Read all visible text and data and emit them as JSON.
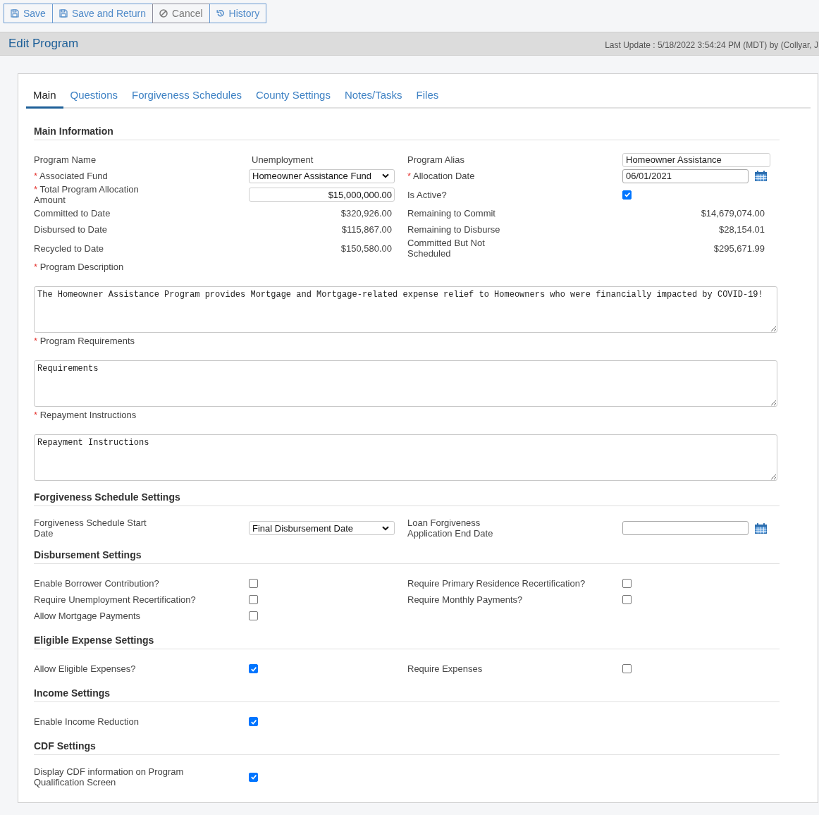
{
  "toolbar": [
    {
      "kind": "save",
      "label": "Save"
    },
    {
      "kind": "save_return",
      "label": "Save and Return"
    },
    {
      "kind": "cancel",
      "label": "Cancel"
    },
    {
      "kind": "history",
      "label": "History"
    }
  ],
  "header": {
    "title": "Edit Program",
    "last_update": "Last Update : 5/18/2022 3:54:24 PM (MDT) by (Collyar, J"
  },
  "tabs": [
    {
      "label": "Main",
      "selected": true
    },
    {
      "label": "Questions",
      "selected": false
    },
    {
      "label": "Forgiveness Schedules",
      "selected": false
    },
    {
      "label": "County Settings",
      "selected": false
    },
    {
      "label": "Notes/Tasks",
      "selected": false
    },
    {
      "label": "Files",
      "selected": false
    }
  ],
  "sections": [
    {
      "title": "Main Information",
      "rows": [
        {
          "fields": [
            {
              "label": "Program Name",
              "kind": "text",
              "value": "Unemployment"
            },
            {
              "label": "Program Alias",
              "kind": "input",
              "value": "Homeowner Assistance"
            }
          ]
        },
        {
          "fields": [
            {
              "label": "Associated Fund",
              "required_mark": "*",
              "kind": "select",
              "value": "Homeowner Assistance Fund"
            },
            {
              "label": "Allocation Date",
              "required_mark": "*",
              "kind": "date",
              "value": "06/01/2021"
            }
          ]
        },
        {
          "fields": [
            {
              "label": "Total Program Allocation Amount",
              "required_mark": "*",
              "kind": "amount_input",
              "value": "$15,000,000.00"
            },
            {
              "label": "Is Active?",
              "kind": "checkbox",
              "checked": true
            }
          ]
        },
        {
          "fields": [
            {
              "label": "Committed to Date",
              "kind": "amount",
              "value": "$320,926.00"
            },
            {
              "label": "Remaining to Commit",
              "kind": "amount",
              "value": "$14,679,074.00"
            }
          ]
        },
        {
          "fields": [
            {
              "label": "Disbursed to Date",
              "kind": "amount",
              "value": "$115,867.00"
            },
            {
              "label": "Remaining to Disburse",
              "kind": "amount",
              "value": "$28,154.01"
            }
          ]
        },
        {
          "fields": [
            {
              "label": "Recycled to Date",
              "kind": "amount",
              "value": "$150,580.00"
            },
            {
              "label": "Committed But Not Scheduled",
              "kind": "amount",
              "value": "$295,671.99"
            }
          ]
        },
        {
          "fields": [
            {
              "label": "Program Description",
              "required_mark": "*",
              "kind": "textarea",
              "value": "The Homeowner Assistance Program provides Mortgage and Mortgage-related expense relief to Homeowners who were financially impacted by COVID-19!"
            }
          ]
        },
        {
          "fields": [
            {
              "label": "Program Requirements",
              "required_mark": "*",
              "kind": "textarea",
              "value": "Requirements"
            }
          ]
        },
        {
          "fields": [
            {
              "label": "Repayment Instructions",
              "required_mark": "*",
              "kind": "textarea",
              "value": "Repayment Instructions"
            }
          ]
        }
      ]
    },
    {
      "title": "Forgiveness Schedule Settings",
      "rows": [
        {
          "fields": [
            {
              "label": "Forgiveness Schedule Start Date",
              "kind": "select",
              "value": "Final Disbursement Date"
            },
            {
              "label": "Loan Forgiveness Application End Date",
              "kind": "date"
            }
          ]
        }
      ]
    },
    {
      "title": "Disbursement Settings",
      "rows": [
        {
          "fields": [
            {
              "label": "Enable Borrower Contribution?",
              "kind": "checkbox",
              "checked": false
            },
            {
              "label": "Require Primary Residence Recertification?",
              "kind": "checkbox",
              "checked": false
            }
          ]
        },
        {
          "fields": [
            {
              "label": "Require Unemployment Recertification?",
              "kind": "checkbox",
              "checked": false
            },
            {
              "label": "Require Monthly Payments?",
              "kind": "checkbox",
              "checked": false
            }
          ]
        },
        {
          "fields": [
            {
              "label": "Allow Mortgage Payments",
              "kind": "checkbox",
              "checked": false
            }
          ]
        }
      ]
    },
    {
      "title": "Eligible Expense Settings",
      "rows": [
        {
          "fields": [
            {
              "label": "Allow Eligible Expenses?",
              "kind": "checkbox",
              "checked": true
            },
            {
              "label": "Require Expenses",
              "kind": "checkbox",
              "checked": false
            }
          ]
        }
      ]
    },
    {
      "title": "Income Settings",
      "rows": [
        {
          "fields": [
            {
              "label": "Enable Income Reduction",
              "kind": "checkbox",
              "checked": true
            }
          ]
        }
      ]
    },
    {
      "title": "CDF Settings",
      "rows": [
        {
          "fields": [
            {
              "label": "Display CDF information on Program Qualification Screen",
              "kind": "checkbox",
              "checked": true
            }
          ]
        }
      ]
    }
  ]
}
